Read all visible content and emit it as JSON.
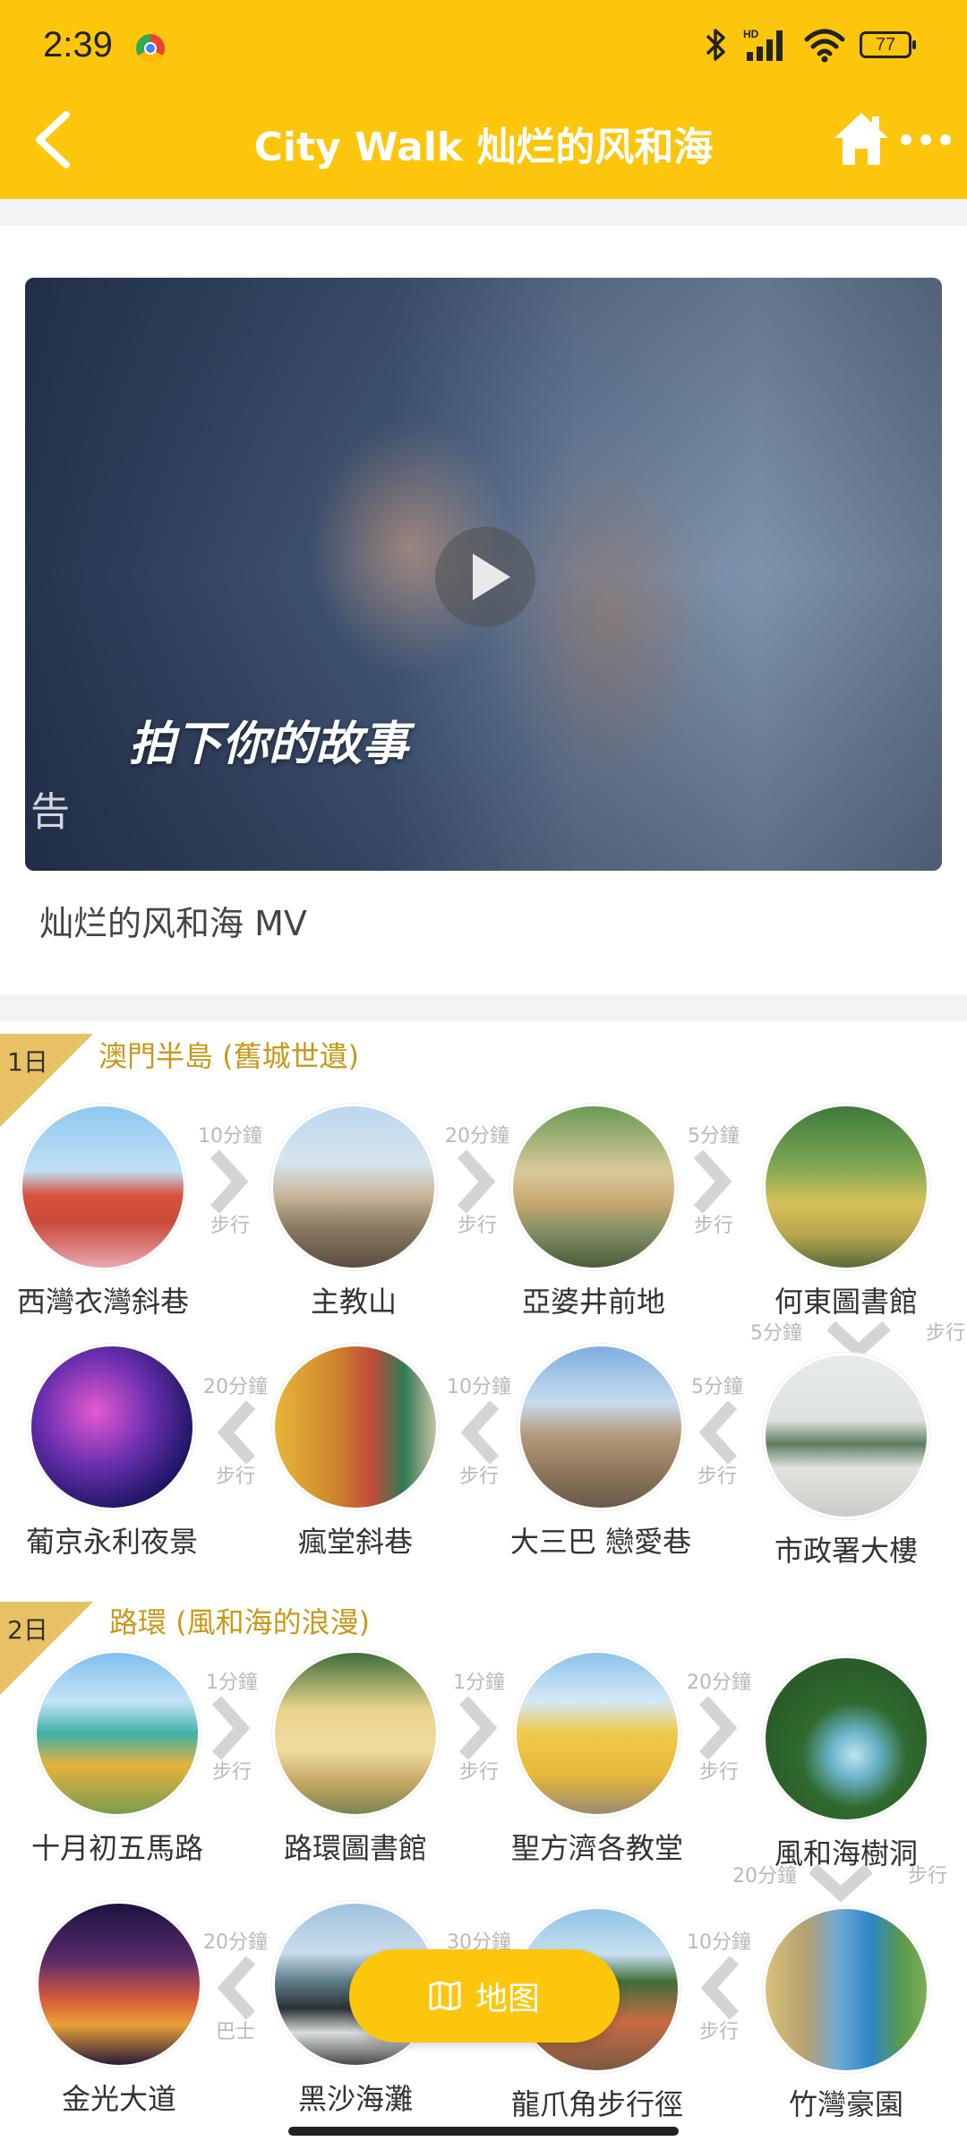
{
  "status_bar": {
    "time": "2:39",
    "battery": "77"
  },
  "header": {
    "title": "City Walk 灿烂的风和海"
  },
  "video": {
    "caption": "拍下你的故事",
    "corner_char": "告",
    "label": "灿烂的风和海 MV"
  },
  "day1": {
    "tag": "1日",
    "title": "澳門半島 (舊城世遺)",
    "row1": {
      "stops": [
        "西灣衣灣斜巷",
        "主教山",
        "亞婆井前地",
        "何東圖書館"
      ],
      "connectors": [
        {
          "time": "10分鐘",
          "mode": "步行"
        },
        {
          "time": "20分鐘",
          "mode": "步行"
        },
        {
          "time": "5分鐘",
          "mode": "步行"
        }
      ]
    },
    "down_connector": {
      "time": "5分鐘",
      "mode": "步行"
    },
    "row2": {
      "stops": [
        "葡京永利夜景",
        "瘋堂斜巷",
        "大三巴 戀愛巷",
        "市政署大樓"
      ],
      "connectors": [
        {
          "time": "20分鐘",
          "mode": "步行"
        },
        {
          "time": "10分鐘",
          "mode": "步行"
        },
        {
          "time": "5分鐘",
          "mode": "步行"
        }
      ]
    }
  },
  "day2": {
    "tag": "2日",
    "title": "路環 (風和海的浪漫)",
    "row1": {
      "stops": [
        "十月初五馬路",
        "路環圖書館",
        "聖方濟各教堂",
        "風和海樹洞"
      ],
      "connectors": [
        {
          "time": "1分鐘",
          "mode": "步行"
        },
        {
          "time": "1分鐘",
          "mode": "步行"
        },
        {
          "time": "20分鐘",
          "mode": "步行"
        }
      ]
    },
    "down_connector": {
      "time": "20分鐘",
      "mode": "步行"
    },
    "row2": {
      "stops": [
        "金光大道",
        "黑沙海灘",
        "龍爪角步行徑",
        "竹灣豪園"
      ],
      "connectors": [
        {
          "time": "20分鐘",
          "mode": "巴士"
        },
        {
          "time": "30分鐘",
          "mode": ""
        },
        {
          "time": "10分鐘",
          "mode": "步行"
        }
      ]
    }
  },
  "map_button": {
    "label": "地图"
  },
  "colors": {
    "brand": "#fbc60c",
    "day_title": "#c9981a",
    "day_tag": "#e7c163"
  }
}
